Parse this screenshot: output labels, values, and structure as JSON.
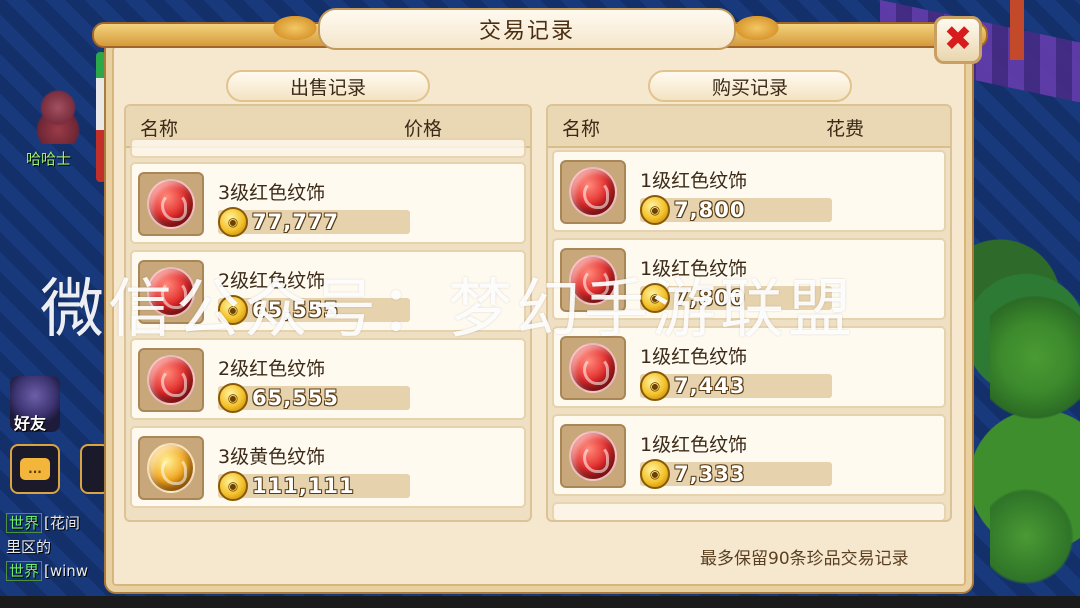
{
  "hud": {
    "npc_name": "哈哈士",
    "friends_label": "好友",
    "chat_icon_text": "...",
    "chat_lines": [
      {
        "channel": "世界",
        "text": "[花间"
      },
      {
        "channel": "",
        "text": "里区的"
      },
      {
        "channel": "世界",
        "text": "[winw"
      }
    ]
  },
  "dialog": {
    "title": "交易记录",
    "close_symbol": "✖",
    "sell": {
      "section_title": "出售记录",
      "col_name": "名称",
      "col_price": "价格",
      "items": [
        {
          "name": "3级红色纹饰",
          "price": "77,777",
          "gem": "red"
        },
        {
          "name": "2级红色纹饰",
          "price": "65,555",
          "gem": "red"
        },
        {
          "name": "2级红色纹饰",
          "price": "65,555",
          "gem": "red"
        },
        {
          "name": "3级黄色纹饰",
          "price": "111,111",
          "gem": "yellow"
        }
      ]
    },
    "buy": {
      "section_title": "购买记录",
      "col_name": "名称",
      "col_cost": "花费",
      "items": [
        {
          "name": "1级红色纹饰",
          "price": "7,800",
          "gem": "red"
        },
        {
          "name": "1级红色纹饰",
          "price": "7,800",
          "gem": "red"
        },
        {
          "name": "1级红色纹饰",
          "price": "7,443",
          "gem": "red"
        },
        {
          "name": "1级红色纹饰",
          "price": "7,333",
          "gem": "red"
        }
      ]
    },
    "footnote": "最多保留90条珍品交易记录"
  },
  "watermark": "微信公众号：梦幻手游联盟",
  "colors": {
    "panel_bg": "#f6e8cf",
    "title_gold": "#d59a3b",
    "close_red": "#d61c1c"
  }
}
